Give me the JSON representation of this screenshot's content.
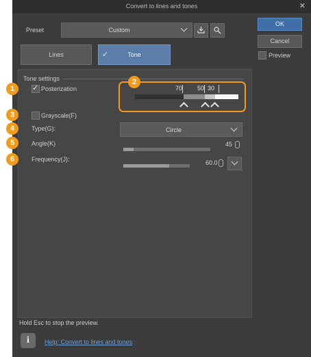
{
  "window": {
    "title": "Convert to lines and tones"
  },
  "preset": {
    "label": "Preset",
    "value": "Custom"
  },
  "buttons": {
    "ok": "OK",
    "cancel": "Cancel",
    "preview": "Preview"
  },
  "tabs": {
    "lines": "Lines",
    "tone": "Tone"
  },
  "tone_settings": {
    "group_label": "Tone settings",
    "posterization": "Posterization",
    "grayscale": "Grayscale(F)",
    "type_label": "Type(G):",
    "type_value": "Circle",
    "angle_label": "Angle(K)",
    "angle_value": "45",
    "frequency_label": "Frequency(J):",
    "frequency_value": "60.0"
  },
  "levels": {
    "v1": "70",
    "v2": "50",
    "v3": "30"
  },
  "badges": [
    "1",
    "2",
    "3",
    "4",
    "5",
    "6"
  ],
  "accent": "#f29b1b",
  "status": {
    "hint": "Hold Esc to stop the preview.",
    "help_link": "Help: Convert to lines and tones"
  }
}
